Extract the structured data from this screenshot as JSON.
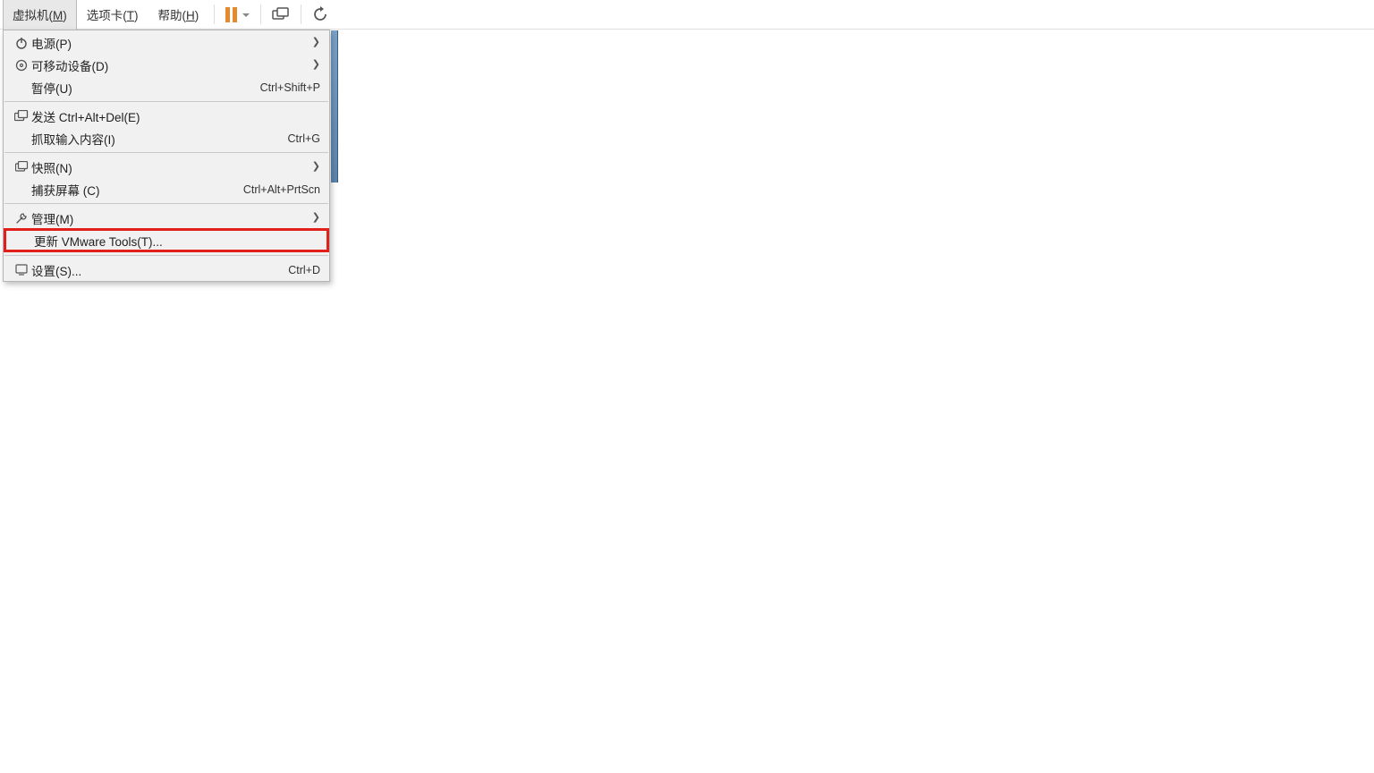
{
  "menubar": {
    "vm": {
      "label": "虚拟机(",
      "accel": "M",
      "suffix": ")"
    },
    "tabs": {
      "label": "选项卡(",
      "accel": "T",
      "suffix": ")"
    },
    "help": {
      "label": "帮助(",
      "accel": "H",
      "suffix": ")"
    }
  },
  "menu": {
    "power": {
      "label": "电源(P)"
    },
    "removable": {
      "label": "可移动设备(D)"
    },
    "pause": {
      "label": "暂停(U)",
      "shortcut": "Ctrl+Shift+P"
    },
    "send_cad": {
      "label": "发送 Ctrl+Alt+Del(E)"
    },
    "grab_input": {
      "label": "抓取输入内容(I)",
      "shortcut": "Ctrl+G"
    },
    "snapshot": {
      "label": "快照(N)"
    },
    "capture": {
      "label": "捕获屏幕 (C)",
      "shortcut": "Ctrl+Alt+PrtScn"
    },
    "manage": {
      "label": "管理(M)"
    },
    "update_tools": {
      "label": "更新 VMware Tools(T)..."
    },
    "settings": {
      "label": "设置(S)...",
      "shortcut": "Ctrl+D"
    }
  }
}
